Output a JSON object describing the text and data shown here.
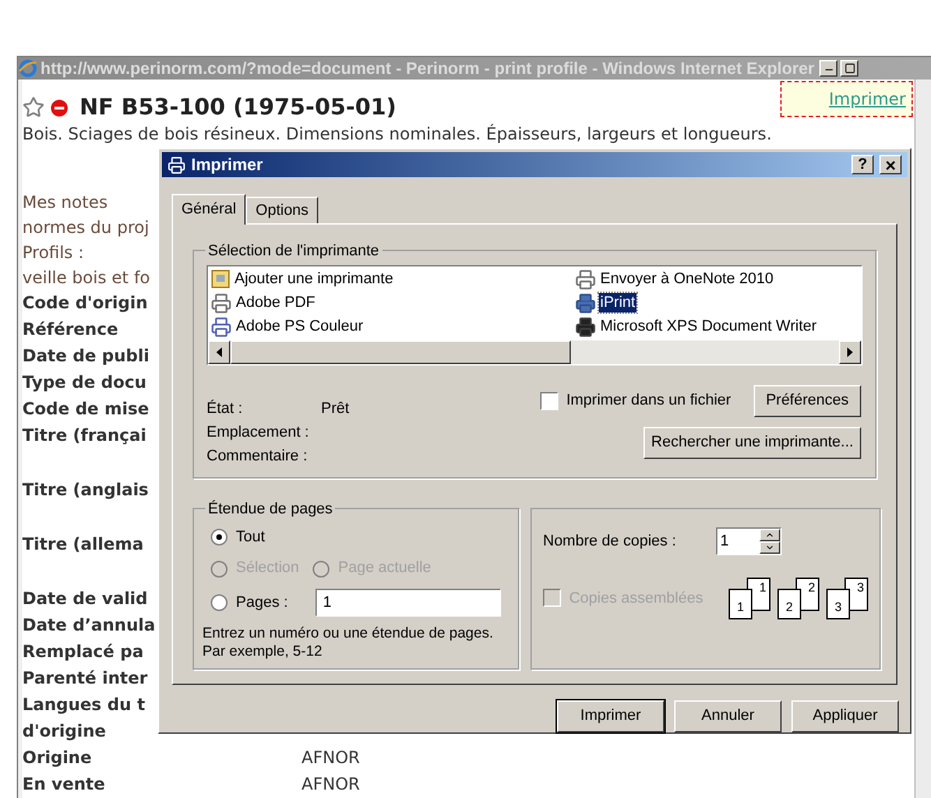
{
  "browser": {
    "title": "http://www.perinorm.com/?mode=document - Perinorm - print profile - Windows Internet Explorer"
  },
  "page": {
    "print_link": "Imprimer",
    "title": "NF B53-100 (1975-05-01)",
    "subtitle": "Bois. Sciages de bois résineux. Dimensions nominales. Épaisseurs, largeurs et longueurs.",
    "lines": [
      {
        "kind": "note",
        "text": "Mes notes"
      },
      {
        "kind": "note",
        "text": "normes du proj"
      },
      {
        "kind": "note",
        "text": "Profils :"
      },
      {
        "kind": "note",
        "text": "veille bois et fo"
      },
      {
        "kind": "label",
        "text": "Code d'origin"
      },
      {
        "kind": "label",
        "text": "Référence"
      },
      {
        "kind": "label",
        "text": "Date de publi"
      },
      {
        "kind": "label",
        "text": "Type de docu"
      },
      {
        "kind": "label",
        "text": "Code de mise"
      },
      {
        "kind": "label",
        "text": "Titre (françai",
        "tall": true
      },
      {
        "kind": "label",
        "text": "Titre (anglais",
        "tall": true
      },
      {
        "kind": "label",
        "text": "Titre (allema",
        "tall": true
      },
      {
        "kind": "label",
        "text": "Date de valid"
      },
      {
        "kind": "label",
        "text": "Date d’annula"
      },
      {
        "kind": "label",
        "text": "Remplacé pa"
      },
      {
        "kind": "label",
        "text": "Parenté inter"
      },
      {
        "kind": "label",
        "text": "Langues du t"
      },
      {
        "kind": "label",
        "text": "d'origine"
      },
      {
        "kind": "label",
        "text": "Origine",
        "value": "AFNOR"
      },
      {
        "kind": "label",
        "text": "En vente",
        "value": "AFNOR"
      }
    ]
  },
  "dialog": {
    "title": "Imprimer",
    "help": "?",
    "close": "×",
    "tabs": [
      {
        "label": "Général",
        "selected": true
      },
      {
        "label": "Options",
        "selected": false
      }
    ],
    "printer_group": {
      "title": "Sélection de l'imprimante",
      "printers": [
        {
          "name": "Ajouter une imprimante",
          "kind": "add",
          "selected": false
        },
        {
          "name": "Adobe PDF",
          "kind": "printer",
          "selected": false
        },
        {
          "name": "Adobe PS Couleur",
          "kind": "fax",
          "selected": false
        },
        {
          "name": "Envoyer à OneNote 2010",
          "kind": "printer",
          "selected": false
        },
        {
          "name": "iPrint",
          "kind": "network",
          "selected": true
        },
        {
          "name": "Microsoft XPS Document Writer",
          "kind": "default",
          "selected": false
        }
      ]
    },
    "info": [
      {
        "label": "État :",
        "value": "Prêt"
      },
      {
        "label": "Emplacement :"
      },
      {
        "label": "Commentaire :"
      }
    ],
    "print_to_file": {
      "label": "Imprimer dans un fichier",
      "checked": false
    },
    "preferences": "Préférences",
    "find_printer": "Rechercher une imprimante...",
    "range_group": {
      "title": "Étendue de pages",
      "options": [
        {
          "label": "Tout",
          "selected": true,
          "disabled": false
        },
        {
          "label": "Sélection",
          "selected": false,
          "disabled": true
        },
        {
          "label": "Page actuelle",
          "selected": false,
          "disabled": true
        },
        {
          "label": "Pages :",
          "selected": false,
          "disabled": false
        }
      ],
      "pages_value": "1",
      "hint": "Entrez un numéro ou une étendue de pages.",
      "example": "Par exemple, 5-12"
    },
    "copies": {
      "label": "Nombre de copies :",
      "value": "1",
      "collate_label": "Copies assemblées",
      "collate_checked": false,
      "collate_disabled": true,
      "pages": [
        {
          "front": "1",
          "back": "1"
        },
        {
          "front": "2",
          "back": "2"
        },
        {
          "front": "3",
          "back": "3"
        }
      ]
    },
    "buttons": [
      {
        "label": "Imprimer",
        "default": true
      },
      {
        "label": "Annuler",
        "default": false
      },
      {
        "label": "Appliquer",
        "default": false
      }
    ]
  }
}
